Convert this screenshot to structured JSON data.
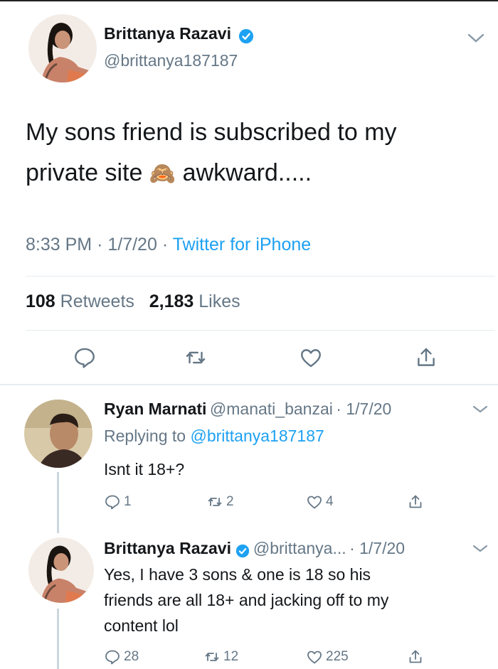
{
  "tweet": {
    "author_name": "Brittanya Razavi",
    "author_handle": "@brittanya187187",
    "text_line1": "My sons friend is subscribed to my",
    "text_line2_a": "private site",
    "text_line2_emoji": "🙈",
    "text_line2_b": "awkward.....",
    "time": "8:33 PM",
    "date": "1/7/20",
    "source": "Twitter for iPhone",
    "retweets_count": "108",
    "retweets_label": "Retweets",
    "likes_count": "2,183",
    "likes_label": "Likes"
  },
  "replies": [
    {
      "author_name": "Ryan Marnati",
      "author_handle": "@manati_banzai",
      "date": "1/7/20",
      "replying_label": "Replying to",
      "replying_handle": "@brittanya187187",
      "text": "Isnt it 18+?",
      "reply_count": "1",
      "retweet_count": "2",
      "like_count": "4"
    },
    {
      "author_name": "Brittanya Razavi",
      "author_handle": "@brittanya...",
      "date": "1/7/20",
      "text_line1": "Yes, I have 3 sons & one is 18 so his",
      "text_line2": "friends are all 18+ and jacking off to my",
      "text_line3": "content lol",
      "reply_count": "28",
      "retweet_count": "12",
      "like_count": "225"
    }
  ],
  "colors": {
    "accent": "#1da1f2",
    "muted": "#657786",
    "text": "#14171a"
  }
}
